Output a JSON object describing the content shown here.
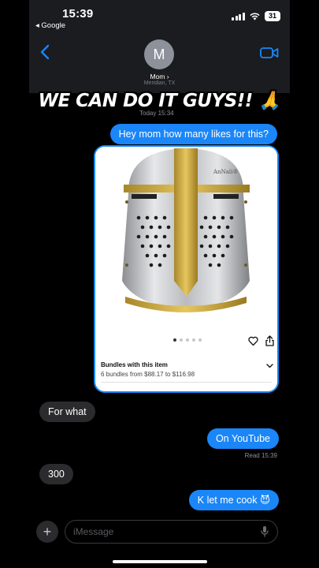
{
  "status_bar": {
    "time": "15:39",
    "back_app": "◂ Google",
    "battery": "31"
  },
  "contact": {
    "initial": "M",
    "name": "Mom ›",
    "location": "Meridian, TX"
  },
  "overlay_caption": "WE CAN DO IT GUYS!! 🙏",
  "timestamp": "Today 15:34",
  "messages": [
    {
      "text": "Hey mom how many likes for this?",
      "direction": "sent"
    },
    {
      "text": "For what",
      "direction": "received"
    },
    {
      "text": "On YouTube",
      "direction": "sent"
    },
    {
      "text": "300",
      "direction": "received"
    },
    {
      "text": "K let me cook 😈",
      "direction": "sent"
    }
  ],
  "read_receipt": "Read 15:39",
  "product_card": {
    "brand_mark": "AnNali®",
    "bundles_title": "Bundles with this item",
    "bundles_subtitle": "6 bundles from $88.17 to $116.98",
    "image_dots": 5,
    "active_dot": 1
  },
  "composer": {
    "placeholder": "iMessage",
    "plus": "+"
  },
  "colors": {
    "sent_bubble": "#1a86f7",
    "received_bubble": "#2b2b2e",
    "background": "#000000"
  },
  "icons": [
    "back-chevron-icon",
    "video-call-icon",
    "heart-icon",
    "share-icon",
    "chevron-down-icon",
    "microphone-icon",
    "wifi-icon",
    "signal-icon"
  ]
}
